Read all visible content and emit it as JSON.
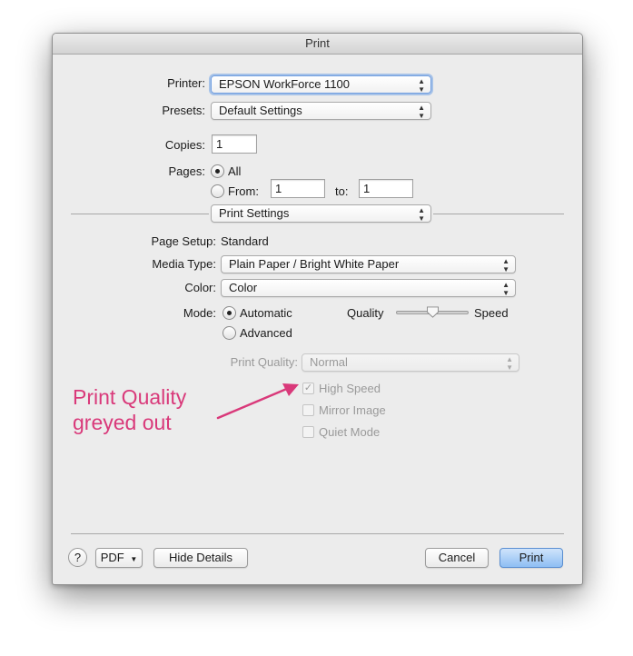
{
  "window": {
    "title": "Print"
  },
  "printer": {
    "label": "Printer:",
    "value": "EPSON WorkForce 1100"
  },
  "presets": {
    "label": "Presets:",
    "value": "Default Settings"
  },
  "copies": {
    "label": "Copies:",
    "value": "1"
  },
  "pages": {
    "label": "Pages:",
    "all_label": "All",
    "from_label": "From:",
    "from_value": "1",
    "to_label": "to:",
    "to_value": "1",
    "selected": "All"
  },
  "section_menu": {
    "value": "Print Settings"
  },
  "page_setup": {
    "label": "Page Setup:",
    "value": "Standard"
  },
  "media_type": {
    "label": "Media Type:",
    "value": "Plain Paper / Bright White Paper"
  },
  "color": {
    "label": "Color:",
    "value": "Color"
  },
  "mode": {
    "label": "Mode:",
    "automatic_label": "Automatic",
    "advanced_label": "Advanced",
    "selected": "Automatic",
    "quality_label": "Quality",
    "speed_label": "Speed",
    "slider_position": 0.5
  },
  "print_quality": {
    "label": "Print Quality:",
    "value": "Normal",
    "enabled": false
  },
  "options": [
    {
      "label": "High Speed",
      "checked": true,
      "enabled": false
    },
    {
      "label": "Mirror Image",
      "checked": false,
      "enabled": false
    },
    {
      "label": "Quiet Mode",
      "checked": false,
      "enabled": false
    }
  ],
  "annotation": {
    "line1": "Print Quality",
    "line2": "greyed out",
    "color": "#d9397a"
  },
  "footer": {
    "help_label": "?",
    "pdf_label": "PDF",
    "hide_details_label": "Hide Details",
    "cancel_label": "Cancel",
    "print_label": "Print"
  }
}
